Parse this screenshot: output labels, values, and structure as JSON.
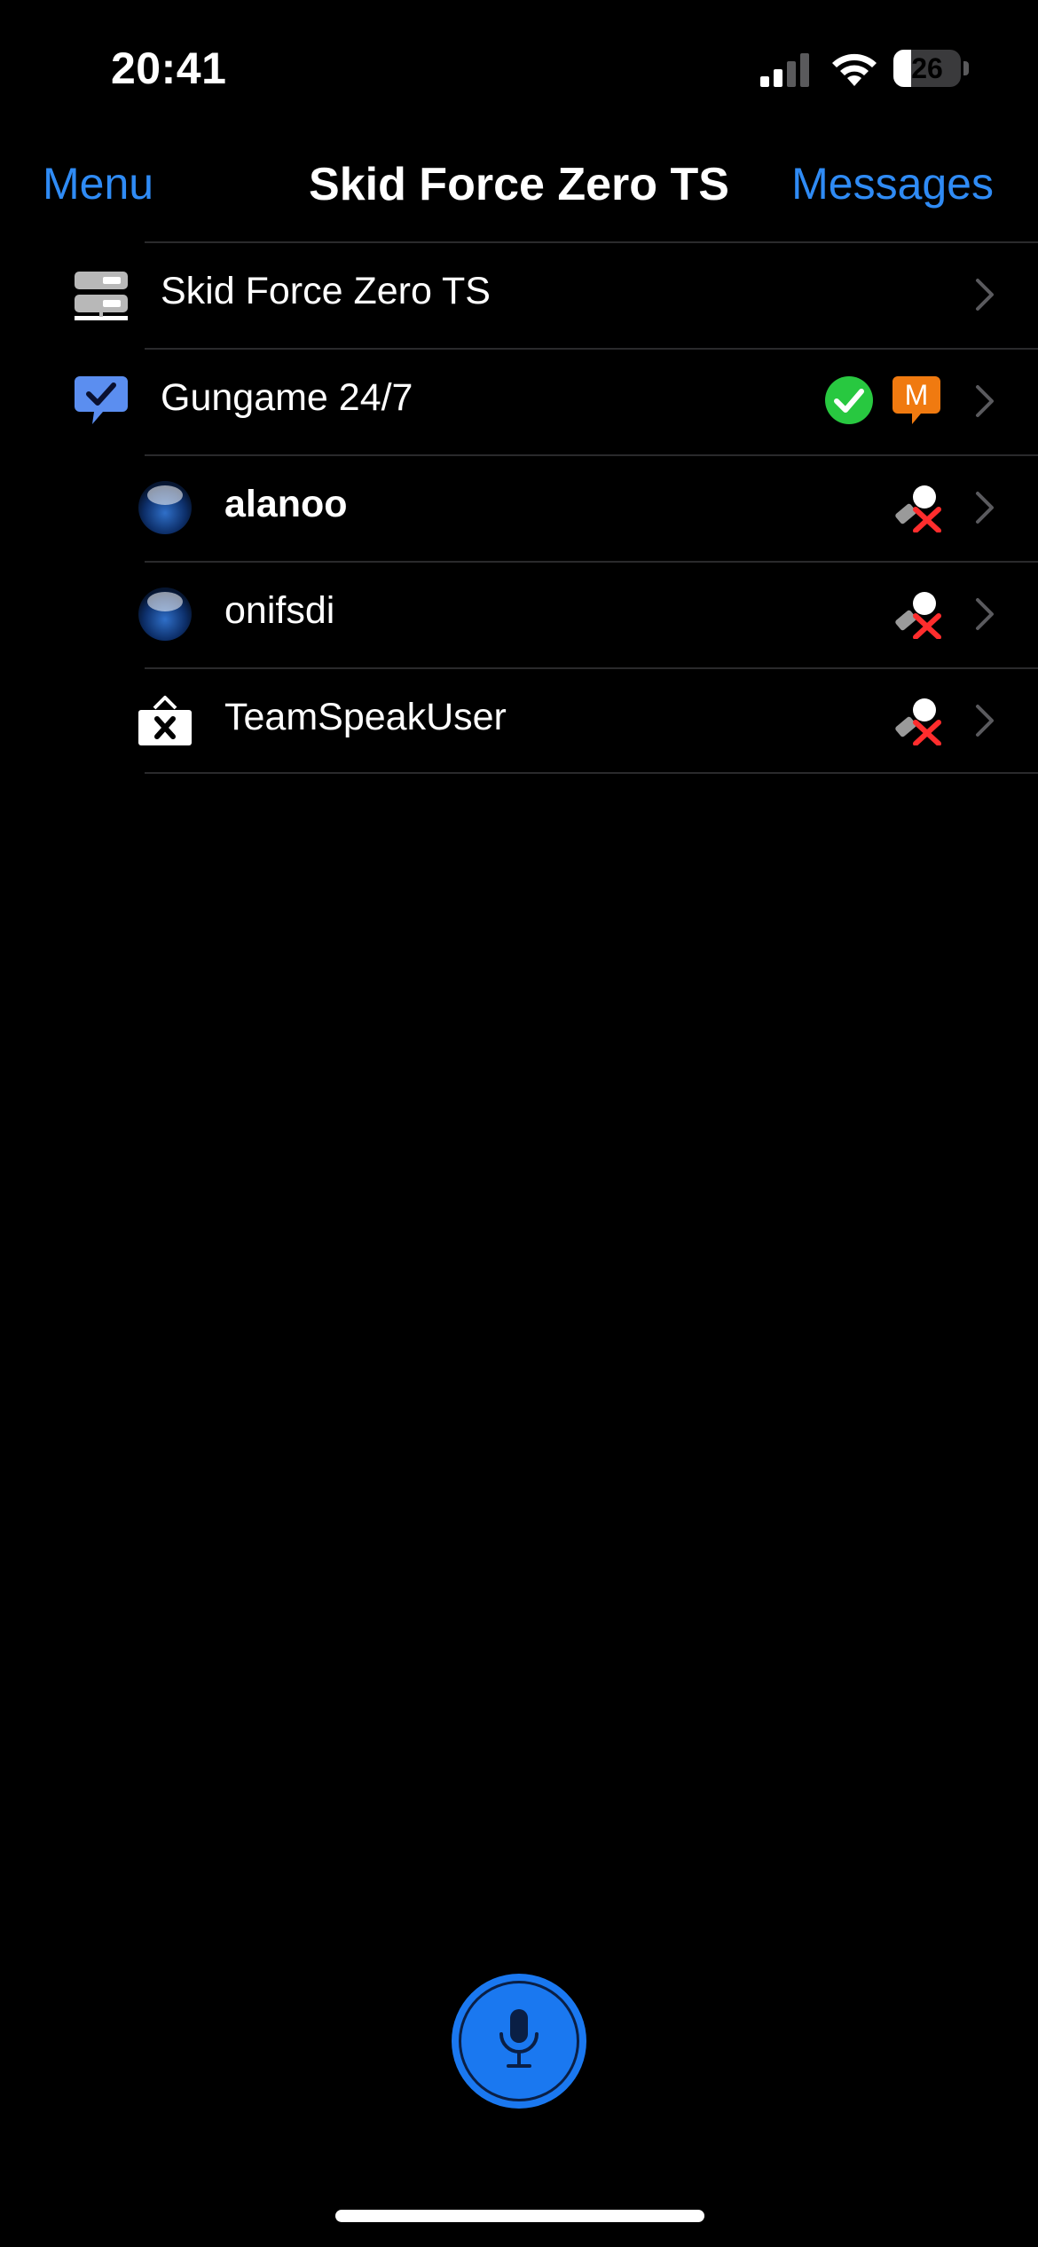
{
  "status_bar": {
    "time": "20:41",
    "battery_level": "26",
    "battery_fraction": 0.26
  },
  "nav": {
    "left_label": "Menu",
    "title": "Skid Force Zero TS",
    "right_label": "Messages"
  },
  "tree": {
    "server": {
      "label": "Skid Force Zero TS",
      "icon": "server-icon"
    },
    "channel": {
      "label": "Gungame 24/7",
      "icon": "channel-subscribed-icon",
      "badges": [
        "check-icon",
        "moderated-icon"
      ],
      "moderated_letter": "M"
    },
    "clients": [
      {
        "label": "alanoo",
        "icon": "client-sphere-icon",
        "bold": true,
        "status_icon": "microphone-muted-icon"
      },
      {
        "label": "onifsdi",
        "icon": "client-sphere-icon",
        "bold": false,
        "status_icon": "microphone-muted-icon"
      },
      {
        "label": "TeamSpeakUser",
        "icon": "client-away-icon",
        "bold": false,
        "status_icon": "microphone-muted-icon"
      }
    ]
  },
  "colors": {
    "accent": "#2f8bf5",
    "mic_button": "#1a78f0",
    "check_green": "#28c840",
    "moderated_orange": "#f07a10",
    "muted_red": "#ff2d2d"
  }
}
